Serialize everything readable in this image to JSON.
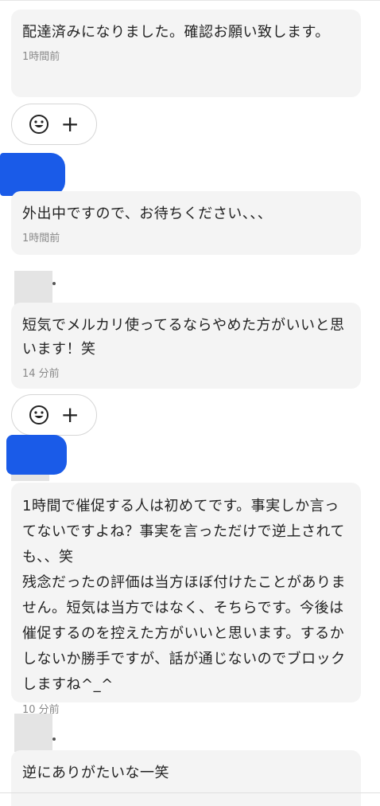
{
  "messages": [
    {
      "text": "配達済みになりました。確認お願い致します。",
      "time": "1時間前"
    },
    {
      "text": "外出中ですので、お待ちください、、、",
      "time": "1時間前"
    },
    {
      "text": "短気でメルカリ使ってるならやめた方がいいと思います！笑",
      "time": "14 分前"
    },
    {
      "text": "1時間で催促する人は初めてです。事実しか言ってないですよね？事実を言っただけで逆上されても、、笑\n残念だったの評価は当方ほぼ付けたことがありません。短気は当方ではなく、そちらです。今後は催促するのを控えた方がいいと思います。するかしないか勝手ですが、話が通じないのでブロックしますね^_^",
      "time": "10 分前"
    },
    {
      "text": "逆にありがたいな一笑",
      "time": ""
    }
  ],
  "reaction_bar": {
    "emoji_icon": "smiley-icon",
    "add_icon": "plus-icon",
    "add_label": "+"
  },
  "colors": {
    "bubble": "#f4f4f4",
    "redaction": "#1a5be8",
    "time": "#8a8a8a"
  }
}
